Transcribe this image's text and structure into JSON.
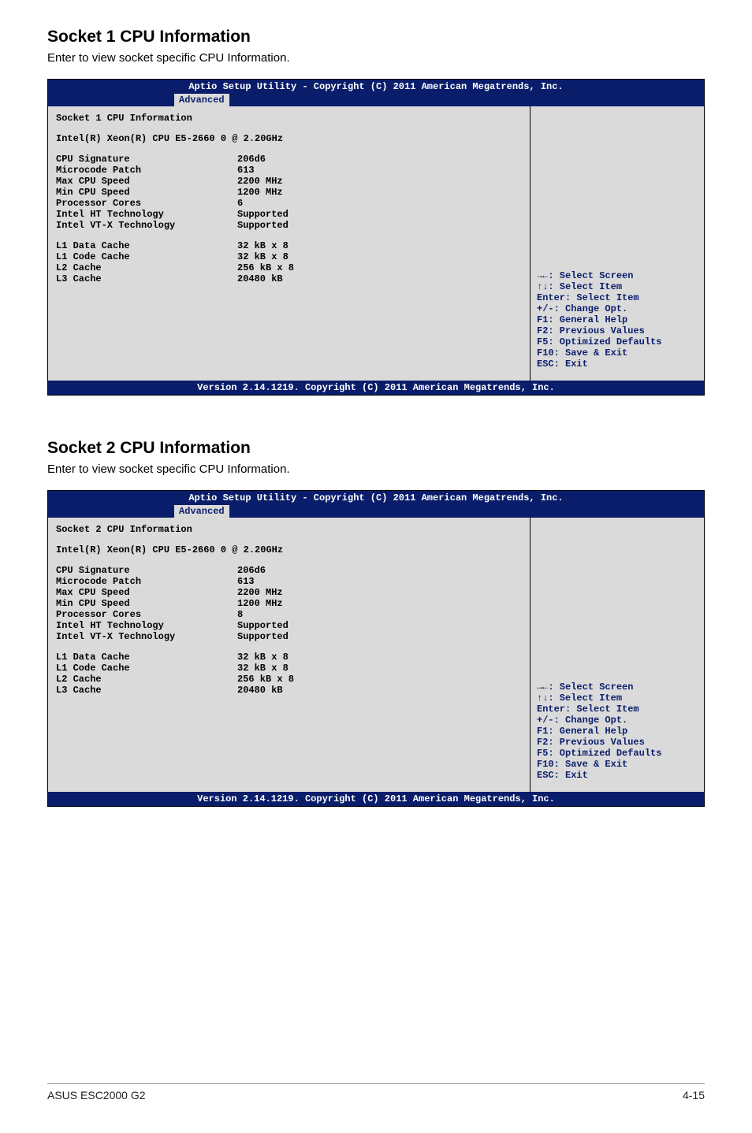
{
  "sections": [
    {
      "heading": "Socket 1 CPU Information",
      "subtext": "Enter to view socket specific CPU Information.",
      "bios": {
        "header": "Aptio Setup Utility - Copyright (C) 2011 American Megatrends, Inc.",
        "tab": "Advanced",
        "title": "Socket 1 CPU Information",
        "cpu_line": "Intel(R) Xeon(R) CPU E5-2660 0 @ 2.20GHz",
        "rows_top": [
          {
            "label": "CPU Signature",
            "value": "206d6"
          },
          {
            "label": "Microcode Patch",
            "value": "613"
          },
          {
            "label": "Max CPU Speed",
            "value": "2200 MHz"
          },
          {
            "label": "Min CPU Speed",
            "value": "1200 MHz"
          },
          {
            "label": "Processor Cores",
            "value": "6"
          },
          {
            "label": "Intel HT Technology",
            "value": "Supported"
          },
          {
            "label": "Intel VT-X Technology",
            "value": "Supported"
          }
        ],
        "rows_bottom": [
          {
            "label": "L1 Data Cache",
            "value": "32 kB x 8"
          },
          {
            "label": "L1 Code Cache",
            "value": "32 kB x 8"
          },
          {
            "label": "L2 Cache",
            "value": "256 kB x 8"
          },
          {
            "label": "L3 Cache",
            "value": "20480 kB"
          }
        ],
        "help": [
          "→←: Select Screen",
          "↑↓:  Select Item",
          "Enter: Select Item",
          "+/-: Change Opt.",
          "F1: General Help",
          "F2: Previous Values",
          "F5: Optimized Defaults",
          "F10: Save & Exit",
          "ESC: Exit"
        ],
        "footer": "Version 2.14.1219. Copyright (C) 2011 American Megatrends, Inc."
      }
    },
    {
      "heading": "Socket 2 CPU Information",
      "subtext": "Enter to view socket specific CPU Information.",
      "bios": {
        "header": "Aptio Setup Utility - Copyright (C) 2011 American Megatrends, Inc.",
        "tab": "Advanced",
        "title": "Socket 2 CPU Information",
        "cpu_line": "Intel(R) Xeon(R) CPU E5-2660 0 @ 2.20GHz",
        "rows_top": [
          {
            "label": "CPU Signature",
            "value": "206d6"
          },
          {
            "label": "Microcode Patch",
            "value": "613"
          },
          {
            "label": "Max CPU Speed",
            "value": "2200 MHz"
          },
          {
            "label": "Min CPU Speed",
            "value": "1200 MHz"
          },
          {
            "label": "Processor Cores",
            "value": "8"
          },
          {
            "label": "Intel HT Technology",
            "value": "Supported"
          },
          {
            "label": "Intel VT-X Technology",
            "value": "Supported"
          }
        ],
        "rows_bottom": [
          {
            "label": "L1 Data Cache",
            "value": "32 kB x 8"
          },
          {
            "label": "L1 Code Cache",
            "value": "32 kB x 8"
          },
          {
            "label": "L2 Cache",
            "value": "256 kB x 8"
          },
          {
            "label": "L3 Cache",
            "value": "20480 kB"
          }
        ],
        "help": [
          "→←: Select Screen",
          "↑↓:  Select Item",
          "Enter: Select Item",
          "+/-: Change Opt.",
          "F1: General Help",
          "F2: Previous Values",
          "F5: Optimized Defaults",
          "F10: Save & Exit",
          "ESC: Exit"
        ],
        "footer": "Version 2.14.1219. Copyright (C) 2011 American Megatrends, Inc."
      }
    }
  ],
  "page_footer": {
    "left": "ASUS ESC2000 G2",
    "right": "4-15"
  }
}
